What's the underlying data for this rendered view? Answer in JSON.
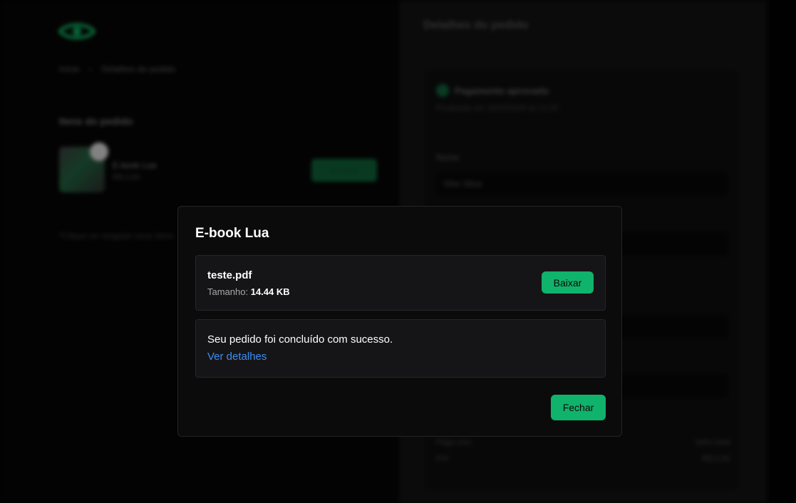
{
  "background": {
    "breadcrumb": [
      "Início",
      "Detalhes do pedido"
    ],
    "items_title": "Itens do pedido",
    "product": {
      "name": "E-book Lua",
      "price": "R$ 0,00",
      "access_label": "Acessar"
    },
    "note": "*Clique no resgatar seus itens",
    "details_title": "Detalhes do pedido",
    "status": {
      "label": "Pagamento aprovado",
      "subtitle": "Finalizado em 18/03/2025 às 21:50"
    },
    "fields": [
      {
        "label": "Nome",
        "value": "Vitor Silva"
      },
      {
        "label": "",
        "value": ""
      },
      {
        "label": "",
        "value": ""
      },
      {
        "label": "",
        "value": ""
      }
    ],
    "summary": [
      {
        "left": "Pago com",
        "right": "Valor total"
      },
      {
        "left": "PIX",
        "right": "R$ 0,00"
      }
    ]
  },
  "modal": {
    "title": "E-book Lua",
    "file": {
      "name": "teste.pdf",
      "size_label": "Tamanho:",
      "size_value": "14.44 KB",
      "download_label": "Baixar"
    },
    "message": "Seu pedido foi concluído com sucesso.",
    "details_link": "Ver detalhes",
    "close_label": "Fechar"
  },
  "colors": {
    "accent": "#10b36b",
    "link": "#3d8ef0",
    "modal_bg": "#0b0b0c",
    "box_bg": "#151517"
  }
}
